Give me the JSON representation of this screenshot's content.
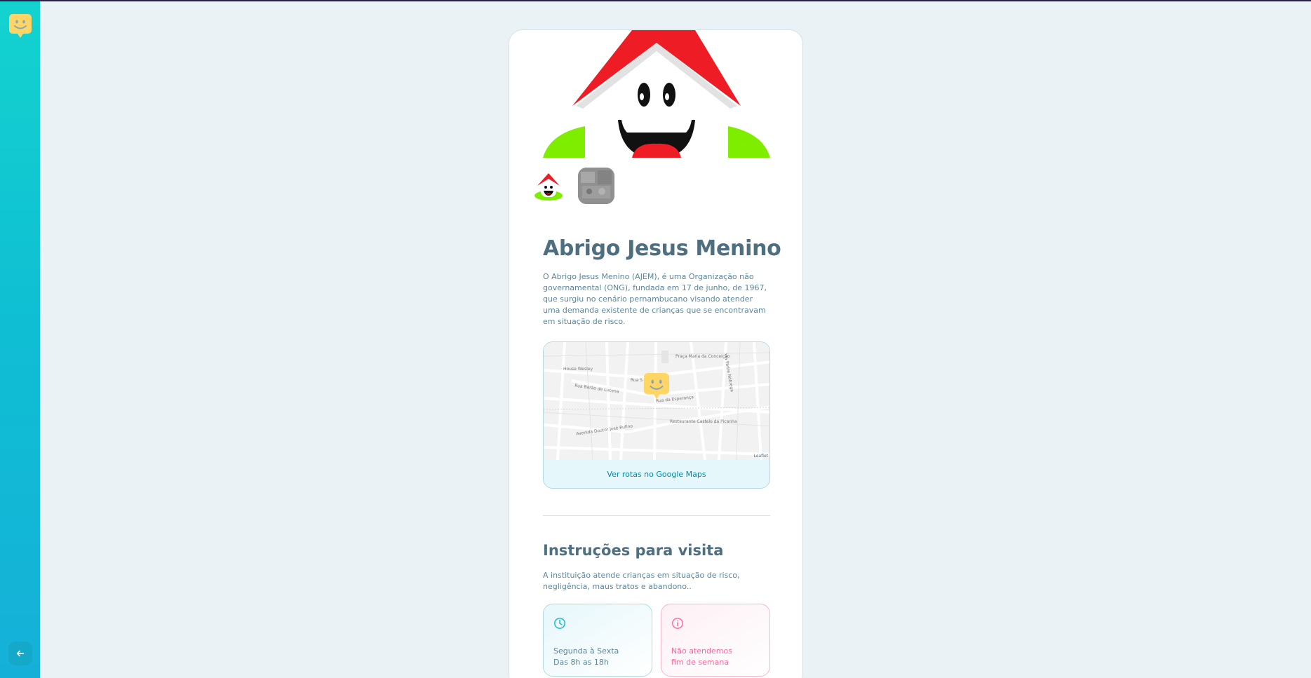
{
  "sidebar": {
    "logo_icon": "happy-face-logo-icon",
    "back_icon": "arrow-left-icon"
  },
  "orphanage": {
    "name": "Abrigo Jesus Menino",
    "about": "O Abrigo Jesus Menino (AJEM), é uma Organização não governamental (ONG), fundada em 17 de junho, de 1967, que surgiu no cenário pernambucano visando atender uma demanda existente de crianças que se encontravam em situação de risco."
  },
  "map": {
    "link_label": "Ver rotas no Google Maps",
    "attribution": "Leaflet",
    "labels": {
      "l1": "Praça Maria da Conceição",
      "l2": "House Wesley",
      "l3": "Rua Barão de Lucena",
      "l4": "Rua da Esperança",
      "l5": "Restaurante Castelo da Picanha",
      "l6": "Avenida Doutor José Rufino",
      "l7": "Rua S",
      "l8": "Via Padre Nóbrega"
    }
  },
  "visit": {
    "title": "Instruções para visita",
    "instructions": "A instituição atende crianças em situação de risco, negligência, maus tratos e abandono..",
    "hours_line1": "Segunda à Sexta",
    "hours_line2": "Das 8h as 18h",
    "weekend_line1": "Não atendemos",
    "weekend_line2": "fim de semana"
  },
  "colors": {
    "sidebar_top": "#14d3cf",
    "sidebar_bottom": "#15b0d8",
    "title": "#4d6f80",
    "text": "#5c8599",
    "link": "#0089a5",
    "pink": "#ff669d",
    "logo_yellow": "#ffd666"
  }
}
